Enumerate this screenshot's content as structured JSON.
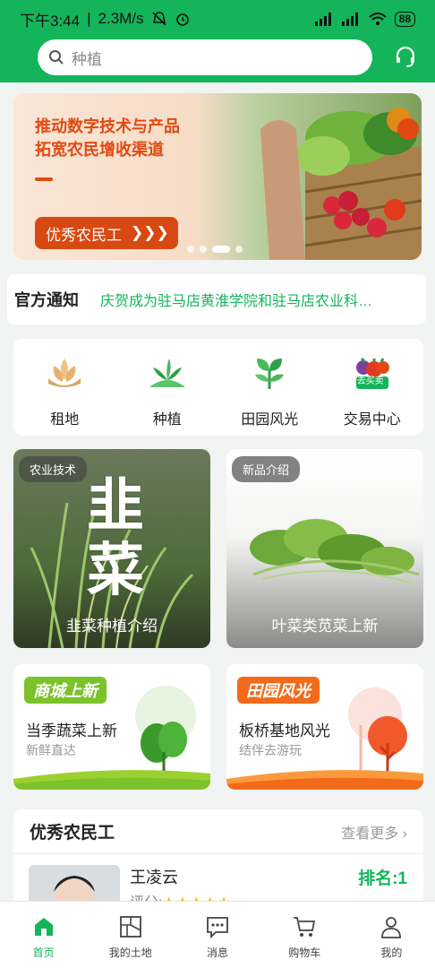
{
  "status_bar": {
    "time": "下午3:44",
    "speed": "2.3M/s",
    "battery": "88"
  },
  "search": {
    "placeholder": "种植"
  },
  "banner": {
    "line1": "推动数字技术与产品",
    "line2": "拓宽农民增收渠道",
    "button_label": "优秀农民工",
    "arrows": "❯❯❯"
  },
  "notice": {
    "label": "官方通知",
    "text": "庆贺成为驻马店黄淮学院和驻马店农业科…"
  },
  "categories": [
    {
      "label": "租地",
      "icon": "lotus-icon"
    },
    {
      "label": "种植",
      "icon": "sprout-icon"
    },
    {
      "label": "田园风光",
      "icon": "leaf-icon"
    },
    {
      "label": "交易中心",
      "icon": "vegetables-icon",
      "badge": "去买卖"
    }
  ],
  "feature_cards": [
    {
      "tag": "农业技术",
      "caption": "韭菜种植介绍",
      "art_chars": [
        "韭",
        "菜"
      ]
    },
    {
      "tag": "新品介绍",
      "caption": "叶菜类苋菜上新"
    }
  ],
  "promo_cards": [
    {
      "badge": "商城上新",
      "title": "当季蔬菜上新",
      "subtitle": "新鲜直达",
      "color": "#7cc22a"
    },
    {
      "badge": "田园风光",
      "title": "板桥基地风光",
      "subtitle": "结伴去游玩",
      "color": "#f26a1b"
    }
  ],
  "workers": {
    "title": "优秀农民工",
    "more": "查看更多",
    "items": [
      {
        "name": "王凌云",
        "rating_label": "评分:",
        "stars": "★★★★★",
        "rank": "排名:1"
      }
    ]
  },
  "tabbar": [
    {
      "label": "首页",
      "icon": "home-icon",
      "active": true
    },
    {
      "label": "我的土地",
      "icon": "land-icon"
    },
    {
      "label": "消息",
      "icon": "message-icon"
    },
    {
      "label": "购物车",
      "icon": "cart-icon"
    },
    {
      "label": "我的",
      "icon": "user-icon"
    }
  ],
  "colors": {
    "brand_green": "#14b45b",
    "banner_orange": "#d84812"
  }
}
